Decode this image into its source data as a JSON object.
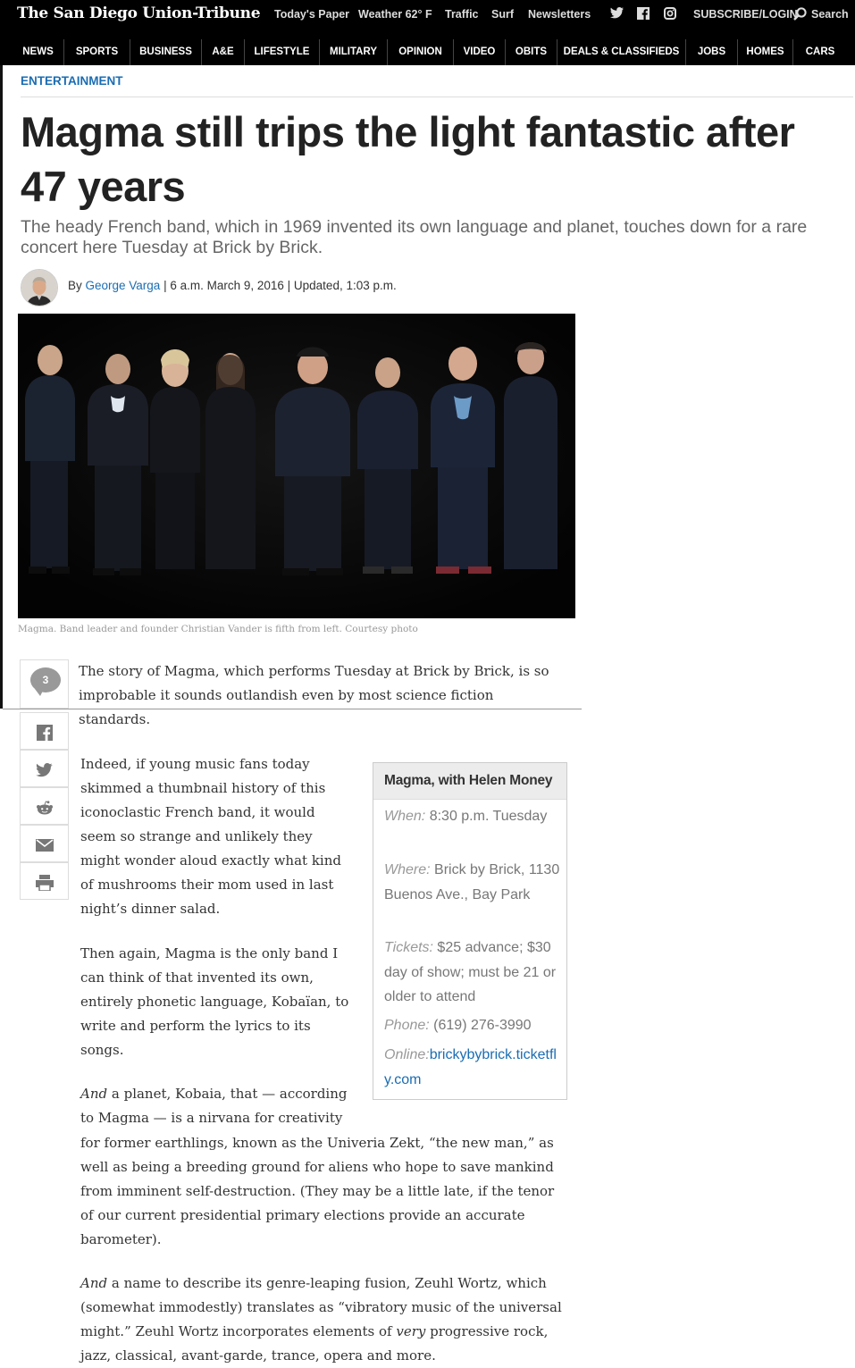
{
  "header": {
    "logo": "The San Diego Union-Tribune",
    "todays_paper": "Today's Paper",
    "weather": "Weather 62° F",
    "traffic": "Traffic",
    "surf": "Surf",
    "newsletters": "Newsletters",
    "subscribe": "SUBSCRIBE/LOGIN",
    "search": "Search"
  },
  "nav": [
    "NEWS",
    "SPORTS",
    "BUSINESS",
    "A&E",
    "LIFESTYLE",
    "MILITARY",
    "OPINION",
    "VIDEO",
    "OBITS",
    "DEALS & CLASSIFIEDS",
    "JOBS",
    "HOMES",
    "CARS"
  ],
  "article": {
    "section": "ENTERTAINMENT",
    "headline": "Magma still trips the light fantastic after 47 years",
    "subhead": "The heady French band, which in 1969 invented its own language and planet, touches down for a rare concert here Tuesday at Brick by Brick.",
    "by": "By ",
    "author": "George Varga",
    "dateline": " | 6 a.m. March 9, 2016 | Updated, 1:03 p.m.",
    "caption": "Magma. Band leader and founder Christian Vander is fifth from left. Courtesy photo",
    "comment_count": "3"
  },
  "body": {
    "p1": "The story of Magma, which performs Tuesday at Brick by Brick, is so improbable it sounds outlandish even by most science fiction standards.",
    "p2": "Indeed, if young music fans today skimmed a thumbnail history of this iconoclastic French band, it would seem so strange and unlikely they might wonder aloud exactly what kind of mushrooms their mom used in last night’s dinner salad.",
    "p3": "Then again, Magma is the only band I can think of that invented its own, entirely phonetic language, Kobaïan, to write and perform the lyrics to its songs.",
    "p4_em": "And",
    "p4_a": " a planet, Kobaia, that — according to Magma — is a nirvana for creativity",
    "p4_b": "for former earthlings, known as the Univeria Zekt, “the new man,” as well as being a breeding ground for aliens who hope to save mankind from imminent self-destruction. (They may be a little late, if the tenor of our current presidential primary elections provide an accurate barometer).",
    "p5_em": "And",
    "p5_a": " a name to describe its genre-leaping fusion, Zeuhl Wortz, which (somewhat immodestly) translates as “vibratory music of the universal might.” Zeuhl Wortz incorporates elements of ",
    "p5_em2": "very",
    "p5_b": " progressive rock, jazz, classical, avant-garde, trance, opera and more."
  },
  "infobox": {
    "title": "Magma, with Helen Money",
    "when_label": "When:",
    "when": " 8:30 p.m. Tuesday",
    "where_label": "Where:",
    "where": " Brick by Brick, 1130 Buenos Ave., Bay Park",
    "tickets_label": "Tickets:",
    "tickets": " $25 advance; $30 day of show; must be 21 or older to attend",
    "phone_label": "Phone:",
    "phone": " (619) 276-3990",
    "online_label": "Online:",
    "online": "brickybybrick.ticketfly.com"
  },
  "icons": [
    "twitter-icon",
    "facebook-icon",
    "instagram-icon",
    "search-icon",
    "comment-icon",
    "reddit-icon",
    "email-icon",
    "print-icon"
  ]
}
